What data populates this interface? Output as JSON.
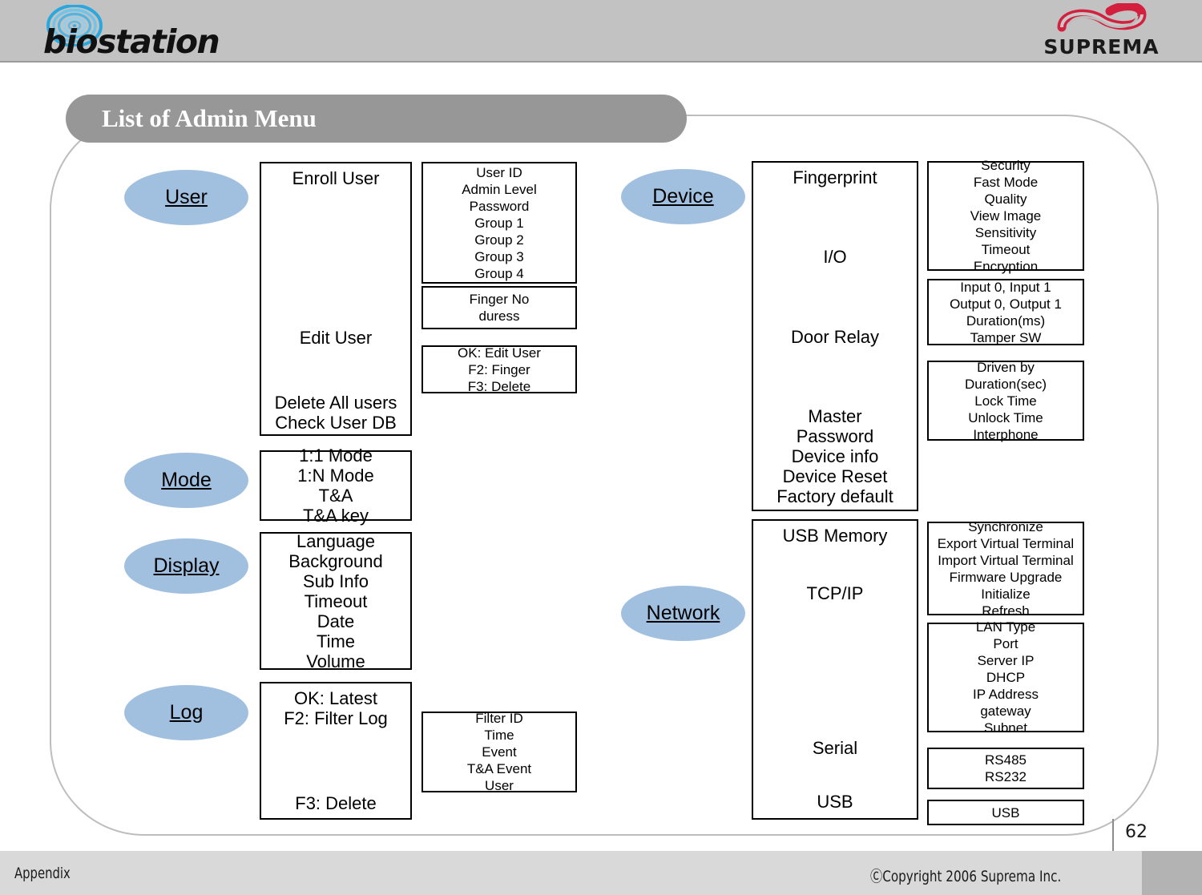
{
  "header": {
    "brand_logo": "biostation",
    "brand_logo_icon": "fingerprint-icon",
    "vendor_logo": "SUPREMA",
    "vendor_logo_icon": "infinity-icon"
  },
  "slide": {
    "title": "List of Admin Menu"
  },
  "colors": {
    "node_fill": "#a1c0e0",
    "title_pill": "#979797",
    "header_band": "#c2c2c2",
    "footer_band": "#d9d9d9",
    "frame_border": "#bdbdbd"
  },
  "nodes": {
    "user": "User",
    "mode": "Mode",
    "display": "Display",
    "log": "Log",
    "device": "Device",
    "network": "Network"
  },
  "user_branch": {
    "level1": {
      "enroll_user": "Enroll User",
      "edit_user": "Edit User",
      "delete_all_users": "Delete All users",
      "check_user_db": "Check User DB"
    },
    "enroll_fields": [
      "User ID",
      "Admin Level",
      "Password",
      "Group 1",
      "Group 2",
      "Group 3",
      "Group 4"
    ],
    "finger_fields": [
      "Finger No",
      "duress"
    ],
    "edit_user_keys": [
      "OK: Edit User",
      "F2: Finger",
      "F3: Delete"
    ]
  },
  "mode_branch": {
    "items": [
      "1:1 Mode",
      "1:N Mode",
      "T&A",
      "T&A key"
    ]
  },
  "display_branch": {
    "items": [
      "Language",
      "Background",
      "Sub Info",
      "Timeout",
      "Date",
      "Time",
      "Volume"
    ]
  },
  "log_branch": {
    "level1": {
      "ok_latest": "OK: Latest",
      "f2_filter_log": "F2: Filter Log",
      "f3_delete": "F3: Delete"
    },
    "filter_fields": [
      "Filter ID",
      "Time",
      "Event",
      "T&A Event",
      "User"
    ]
  },
  "device_branch": {
    "level1": {
      "fingerprint": "Fingerprint",
      "io": "I/O",
      "door_relay": "Door Relay",
      "master": "Master",
      "password": "Password",
      "device_info": "Device info",
      "device_reset": "Device Reset",
      "factory_default": "Factory default"
    },
    "fingerprint_fields": [
      "Security",
      "Fast Mode",
      "Quality",
      "View Image",
      "Sensitivity",
      "Timeout",
      "Encryption"
    ],
    "io_fields": [
      "Input 0, Input 1",
      "Output 0, Output 1",
      "Duration(ms)",
      "Tamper SW"
    ],
    "door_relay_fields": [
      "Driven by",
      "Duration(sec)",
      "Lock Time",
      "Unlock Time",
      "Interphone"
    ]
  },
  "network_branch": {
    "level1": {
      "usb_memory": "USB Memory",
      "tcp_ip": "TCP/IP",
      "serial": "Serial",
      "usb": "USB"
    },
    "usb_memory_fields": [
      "Synchronize",
      "Export Virtual Terminal",
      "Import Virtual Terminal",
      "Firmware Upgrade",
      "Initialize",
      "Refresh"
    ],
    "tcp_ip_fields": [
      "LAN Type",
      "Port",
      "Server IP",
      "DHCP",
      "IP Address",
      "gateway",
      "Subnet"
    ],
    "serial_fields": [
      "RS485",
      "RS232"
    ],
    "usb_fields": [
      "USB"
    ]
  },
  "footer": {
    "section": "Appendix",
    "copyright": "ⒸCopyright 2006 Suprema Inc.",
    "page_number": "62"
  }
}
